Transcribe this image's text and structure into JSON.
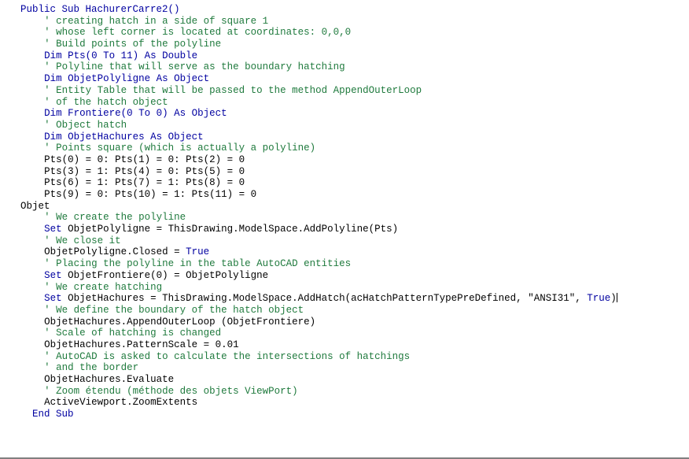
{
  "editor": {
    "language": "VBA",
    "colors": {
      "background": "#ffffff",
      "keyword": "#0000A0",
      "identifier": "#000000",
      "comment": "#1F7A3D",
      "border": "#808080"
    },
    "caret": {
      "visible": true,
      "line_index": 31
    }
  },
  "lines": [
    {
      "indent": 2,
      "segments": [
        {
          "t": "kw",
          "v": "Public Sub HachurerCarre2()"
        }
      ]
    },
    {
      "indent": 6,
      "segments": [
        {
          "t": "cmt",
          "v": "' creating hatch in a side of square 1"
        }
      ]
    },
    {
      "indent": 6,
      "segments": [
        {
          "t": "cmt",
          "v": "' whose left corner is located at coordinates: 0,0,0"
        }
      ]
    },
    {
      "indent": 6,
      "segments": [
        {
          "t": "cmt",
          "v": "' Build points of the polyline"
        }
      ]
    },
    {
      "indent": 6,
      "segments": [
        {
          "t": "kw",
          "v": "Dim Pts(0 To 11) As Double"
        }
      ]
    },
    {
      "indent": 6,
      "segments": [
        {
          "t": "cmt",
          "v": "' Polyline that will serve as the boundary hatching"
        }
      ]
    },
    {
      "indent": 6,
      "segments": [
        {
          "t": "kw",
          "v": "Dim ObjetPolyligne As Object"
        }
      ]
    },
    {
      "indent": 6,
      "segments": [
        {
          "t": "cmt",
          "v": "' Entity Table that will be passed to the method AppendOuterLoop"
        }
      ]
    },
    {
      "indent": 6,
      "segments": [
        {
          "t": "cmt",
          "v": "' of the hatch object"
        }
      ]
    },
    {
      "indent": 6,
      "segments": [
        {
          "t": "kw",
          "v": "Dim Frontiere(0 To 0) As Object"
        }
      ]
    },
    {
      "indent": 6,
      "segments": [
        {
          "t": "cmt",
          "v": "' Object hatch"
        }
      ]
    },
    {
      "indent": 6,
      "segments": [
        {
          "t": "kw",
          "v": "Dim ObjetHachures As Object"
        }
      ]
    },
    {
      "indent": 6,
      "segments": [
        {
          "t": "cmt",
          "v": "' Points square (which is actually a polyline)"
        }
      ]
    },
    {
      "indent": 6,
      "segments": [
        {
          "t": "plain",
          "v": "Pts(0) = 0: Pts(1) = 0: Pts(2) = 0"
        }
      ]
    },
    {
      "indent": 6,
      "segments": [
        {
          "t": "plain",
          "v": "Pts(3) = 1: Pts(4) = 0: Pts(5) = 0"
        }
      ]
    },
    {
      "indent": 6,
      "segments": [
        {
          "t": "plain",
          "v": "Pts(6) = 1: Pts(7) = 1: Pts(8) = 0"
        }
      ]
    },
    {
      "indent": 6,
      "segments": [
        {
          "t": "plain",
          "v": "Pts(9) = 0: Pts(10) = 1: Pts(11) = 0"
        }
      ]
    },
    {
      "indent": 2,
      "segments": [
        {
          "t": "plain",
          "v": "Objet"
        }
      ]
    },
    {
      "indent": 6,
      "segments": [
        {
          "t": "cmt",
          "v": "' We create the polyline"
        }
      ]
    },
    {
      "indent": 6,
      "segments": [
        {
          "t": "kw",
          "v": "Set "
        },
        {
          "t": "plain",
          "v": "ObjetPolyligne = ThisDrawing.ModelSpace.AddPolyline(Pts)"
        }
      ]
    },
    {
      "indent": 6,
      "segments": [
        {
          "t": "cmt",
          "v": "' We close it"
        }
      ]
    },
    {
      "indent": 6,
      "segments": [
        {
          "t": "plain",
          "v": "ObjetPolyligne.Closed = "
        },
        {
          "t": "kw",
          "v": "True"
        }
      ]
    },
    {
      "indent": 6,
      "segments": [
        {
          "t": "cmt",
          "v": "' Placing the polyline in the table AutoCAD entities"
        }
      ]
    },
    {
      "indent": 6,
      "segments": [
        {
          "t": "kw",
          "v": "Set "
        },
        {
          "t": "plain",
          "v": "ObjetFrontiere(0) = ObjetPolyligne"
        }
      ]
    },
    {
      "indent": 6,
      "segments": [
        {
          "t": "cmt",
          "v": "' We create hatching"
        }
      ]
    },
    {
      "indent": 6,
      "segments": [
        {
          "t": "kw",
          "v": "Set "
        },
        {
          "t": "plain",
          "v": "ObjetHachures = ThisDrawing.ModelSpace.AddHatch(acHatchPatternTypePreDefined, \"ANSI31\", "
        },
        {
          "t": "kw",
          "v": "True"
        },
        {
          "t": "plain",
          "v": ")"
        },
        {
          "t": "caret",
          "v": ""
        }
      ]
    },
    {
      "indent": 6,
      "segments": [
        {
          "t": "cmt",
          "v": "' We define the boundary of the hatch object"
        }
      ]
    },
    {
      "indent": 6,
      "segments": [
        {
          "t": "plain",
          "v": "ObjetHachures.AppendOuterLoop (ObjetFrontiere)"
        }
      ]
    },
    {
      "indent": 6,
      "segments": [
        {
          "t": "cmt",
          "v": "' Scale of hatching is changed"
        }
      ]
    },
    {
      "indent": 6,
      "segments": [
        {
          "t": "plain",
          "v": "ObjetHachures.PatternScale = 0.01"
        }
      ]
    },
    {
      "indent": 6,
      "segments": [
        {
          "t": "cmt",
          "v": "' AutoCAD is asked to calculate the intersections of hatchings"
        }
      ]
    },
    {
      "indent": 6,
      "segments": [
        {
          "t": "cmt",
          "v": "' and the border"
        }
      ]
    },
    {
      "indent": 6,
      "segments": [
        {
          "t": "plain",
          "v": "ObjetHachures.Evaluate"
        }
      ]
    },
    {
      "indent": 6,
      "segments": [
        {
          "t": "cmt",
          "v": "' Zoom étendu (méthode des objets ViewPort)"
        }
      ]
    },
    {
      "indent": 6,
      "segments": [
        {
          "t": "plain",
          "v": "ActiveViewport.ZoomExtents"
        }
      ]
    },
    {
      "indent": 4,
      "segments": [
        {
          "t": "kw",
          "v": "End Sub"
        }
      ]
    }
  ]
}
